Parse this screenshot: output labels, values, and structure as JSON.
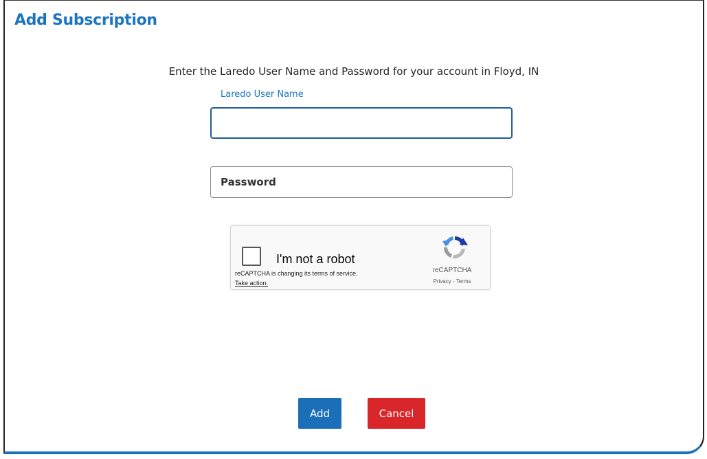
{
  "dialog": {
    "title": "Add Subscription",
    "instructions": "Enter the Laredo User Name and Password for your account in Floyd, IN"
  },
  "form": {
    "username_label": "Laredo User Name",
    "username_value": "",
    "password_placeholder": "Password",
    "password_value": ""
  },
  "recaptcha": {
    "label": "I'm not a robot",
    "notice": "reCAPTCHA is changing its terms of service.",
    "action_link": "Take action.",
    "brand": "reCAPTCHA",
    "links": "Privacy - Terms",
    "checked": false
  },
  "buttons": {
    "add_label": "Add",
    "cancel_label": "Cancel"
  },
  "colors": {
    "accent": "#1a74c2",
    "add_button": "#1a6fb8",
    "cancel_button": "#d8262b"
  },
  "icons": {
    "recaptcha_logo": "recaptcha-logo-icon"
  }
}
